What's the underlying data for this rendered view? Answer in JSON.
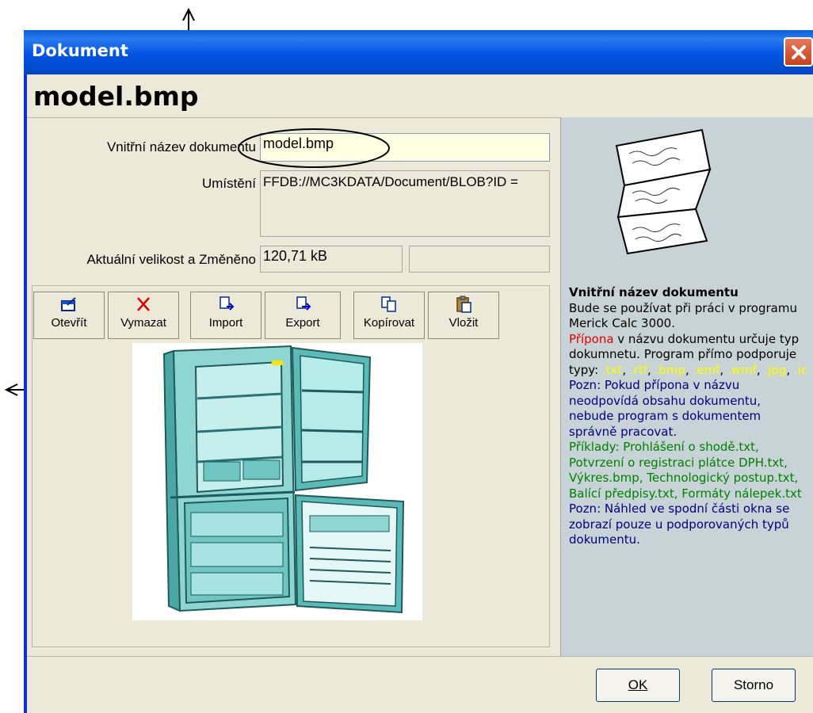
{
  "window": {
    "title": "Dokument"
  },
  "heading": "model.bmp",
  "form": {
    "name_label": "Vnitřní název dokumentu",
    "name_value": "model.bmp",
    "location_label": "Umístění",
    "location_value": "FFDB://MC3KDATA/Document/BLOB?ID =",
    "size_label": "Aktuální velikost a Změněno",
    "size_value": "120,71 kB",
    "date_value": ""
  },
  "toolbar": [
    {
      "label": "Otevřít",
      "icon": "open-icon"
    },
    {
      "label": "Vymazat",
      "icon": "delete-icon"
    },
    {
      "label": "Import",
      "icon": "import-icon"
    },
    {
      "label": "Export",
      "icon": "export-icon"
    },
    {
      "label": "Kopírovat",
      "icon": "copy-icon"
    },
    {
      "label": "Vložit",
      "icon": "paste-icon"
    }
  ],
  "help": {
    "title": "Vnitřní název dokumentu",
    "p1": "Bude se používat při práci v programu Merick Calc 3000.",
    "p2_red": "Přípona",
    "p2_rest": " v názvu dokumentu určuje typ dokumnetu. Program přímo podporuje typy: ",
    "types": [
      ".txt",
      ".rtf",
      ".bmp",
      ".emf",
      ".wmf",
      ".jpg",
      ".ic"
    ],
    "note1": "Pozn: Pokud přípona v názvu neodpovídá obsahu dokumentu, nebude program s dokumentem správně pracovat.",
    "examples": "Příklady: Prohlášení o shodě.txt, Potvrzení o registraci plátce DPH.txt, Výkres.bmp, Technologický postup.txt, Balící předpisy.txt, Formáty nálepek.txt",
    "note2": "Pozn: Náhled ve spodní části okna se zobrazí pouze u podporovaných typů dokumentu."
  },
  "buttons": {
    "ok": "OK",
    "cancel": "Storno"
  },
  "colors": {
    "titlebar": "#0054e3",
    "help_bg": "#c7d3d6",
    "input_highlight": "#ffffe1"
  }
}
